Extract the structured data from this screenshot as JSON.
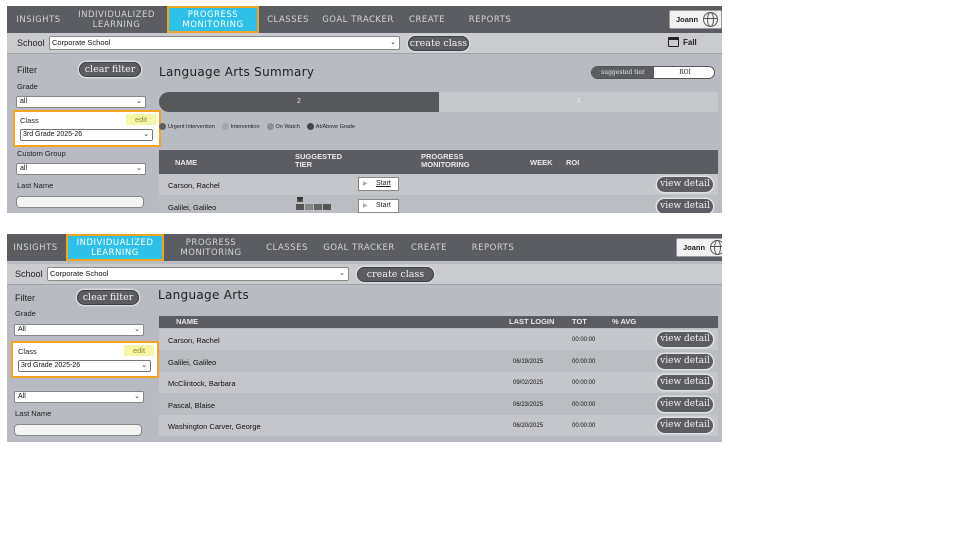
{
  "top": {
    "nav": {
      "insights": "INSIGHTS",
      "individualized": "INDIVIDUALIZED LEARNING",
      "progress": "PROGRESS MONITORING",
      "classes": "CLASSES",
      "goal_tracker": "GOAL TRACKER",
      "create": "CREATE",
      "reports": "REPORTS",
      "user": "Joann"
    },
    "school_label": "School",
    "school_value": "Corporate School",
    "create_class": "create class",
    "season": "Fall",
    "filter_label": "Filter",
    "clear_filter": "clear filter",
    "grade_label": "Grade",
    "grade_value": "all",
    "class_label": "Class",
    "edit_label": "edit",
    "class_value": "3rd Grade 2025-26",
    "custom_group_label": "Custom Group",
    "custom_group_value": "all",
    "last_name_label": "Last Name",
    "title": "Language Arts Summary",
    "toggle_left": "suggested tier",
    "toggle_right": "ROI",
    "tier_dark_count": "2",
    "tier_light_count": "3",
    "tier_dark_share": 0.5,
    "legend": [
      "Urgent Intervention",
      "Intervention",
      "On Watch",
      "At/Above Grade"
    ],
    "legend_colors": [
      "#5b5d62",
      "#a3a6ab",
      "#8c8f94",
      "#444649"
    ],
    "columns": {
      "name": "NAME",
      "tier": "SUGGESTED TIER",
      "progress": "PROGRESS MONITORING",
      "week": "WEEK",
      "roi": "ROI"
    },
    "rows": [
      {
        "name": "Carson, Rachel",
        "start": "Start",
        "action": "view detail"
      },
      {
        "name": "Galilei, Galileo",
        "start": "Start",
        "action": "view detail"
      }
    ]
  },
  "bottom": {
    "nav": {
      "insights": "INSIGHTS",
      "individualized": "INDIVIDUALIZED LEARNING",
      "progress": "PROGRESS MONITORING",
      "classes": "CLASSES",
      "goal_tracker": "GOAL TRACKER",
      "create": "CREATE",
      "reports": "REPORTS",
      "user": "Joann"
    },
    "school_label": "School",
    "school_value": "Corporate School",
    "create_class": "create class",
    "filter_label": "Filter",
    "clear_filter": "clear filter",
    "grade_label": "Grade",
    "grade_value": "All",
    "class_label": "Class",
    "edit_label": "edit",
    "class_value": "3rd Grade 2025-26",
    "extra_select_value": "All",
    "last_name_label": "Last Name",
    "title": "Language Arts",
    "columns": {
      "name": "NAME",
      "last_login": "LAST LOGIN",
      "tot": "TOT",
      "avg": "% AVG"
    },
    "rows": [
      {
        "name": "Carson, Rachel",
        "last_login": "",
        "tot": "00:00:00",
        "action": "view detail"
      },
      {
        "name": "Galilei, Galileo",
        "last_login": "06/19/2025",
        "tot": "00:00:00",
        "action": "view detail"
      },
      {
        "name": "McClintock, Barbara",
        "last_login": "09/02/2025",
        "tot": "00:00:00",
        "action": "view detail"
      },
      {
        "name": "Pascal, Blaise",
        "last_login": "06/23/2025",
        "tot": "00:00:00",
        "action": "view detail"
      },
      {
        "name": "Washington Carver, George",
        "last_login": "06/20/2025",
        "tot": "00:00:00",
        "action": "view detail"
      }
    ]
  },
  "colors": {
    "nav_bg": "#5b5d62",
    "active_tab": "#2fc0e8",
    "highlight_outline": "#f1a323",
    "panel_bg": "#b8bbc1"
  }
}
